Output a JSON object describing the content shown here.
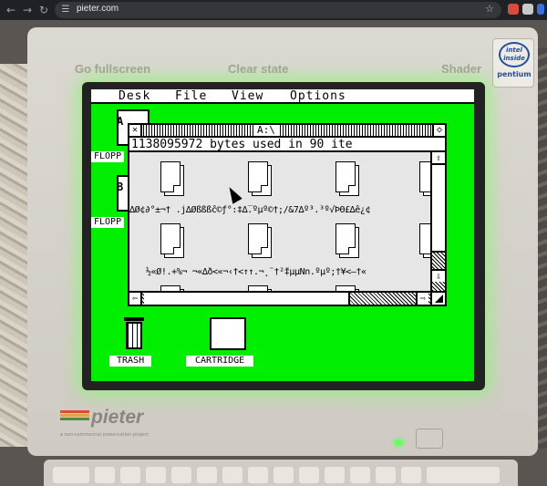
{
  "browser": {
    "url": "pieter.com",
    "back_icon": "arrow-left-icon",
    "forward_icon": "arrow-right-icon",
    "reload_icon": "reload-icon"
  },
  "page_menu": {
    "fullscreen": "Go fullscreen",
    "clear": "Clear state",
    "shader": "Shader"
  },
  "intel": {
    "badge": "intel inside",
    "proc": "pentium"
  },
  "brand": {
    "logo": "pieter",
    "tagline": "a non-commercial preservation project"
  },
  "gem": {
    "menu": [
      "Desk",
      "File",
      "View",
      "Options"
    ],
    "desktop_icons": [
      {
        "label": "FLOPP",
        "drive": "A"
      },
      {
        "label": "FLOPP",
        "drive": "B"
      },
      {
        "label": "TRASH"
      },
      {
        "label": "CARTRIDGE"
      }
    ],
    "window": {
      "title": "A:\\",
      "info": "1138095972 bytes used in 90 ite",
      "rows": [
        "∆Ø¢∂°±¬† .j∆Øßßßĉ©ƒ°:‡∆̅.ºµº©†;/&7∆º³.³º√ÞΘ£∆ê¿¢",
        "½«Ø!.+%¬  ¬«∆ð<«¬‹†<↑↑.¬¸¨†²̈‡µµNn.ºµº;†¥<–†«"
      ]
    }
  },
  "colors": {
    "screen": "#00ee00",
    "glow": "#78ff5a"
  }
}
